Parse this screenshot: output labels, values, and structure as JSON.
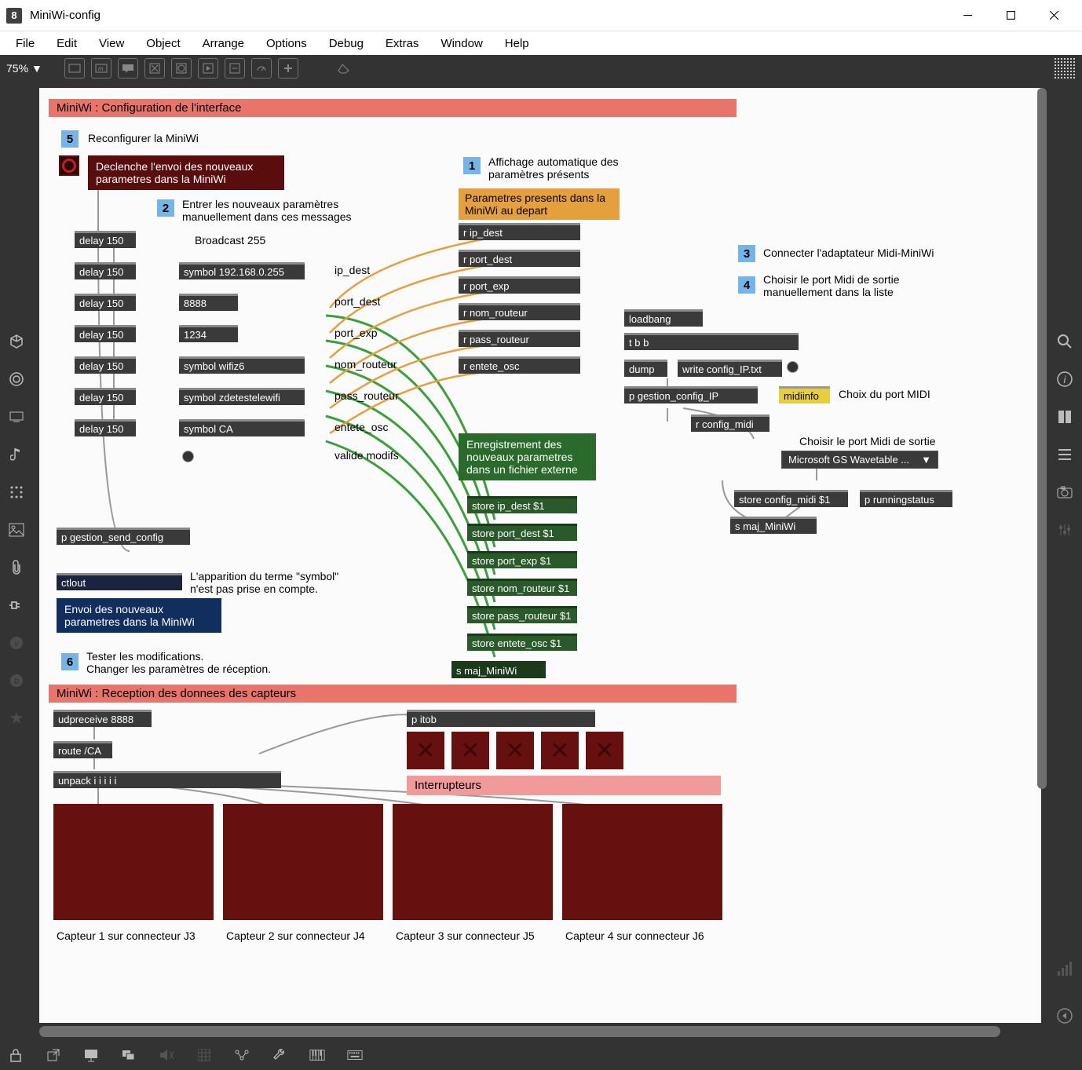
{
  "window": {
    "title": "MiniWi-config"
  },
  "menu": {
    "file": "File",
    "edit": "Edit",
    "view": "View",
    "object": "Object",
    "arrange": "Arrange",
    "options": "Options",
    "debug": "Debug",
    "extras": "Extras",
    "window": "Window",
    "help": "Help"
  },
  "toolbar": {
    "zoom": "75%"
  },
  "patch": {
    "header1": "MiniWi : Configuration de l'interface",
    "header2": "MiniWi : Reception des donnees des capteurs",
    "step5": "5",
    "step5_label": "Reconfigurer la MiniWi",
    "step1": "1",
    "step1_label": "Affichage automatique des paramètres présents",
    "step2": "2",
    "step2_label": "Entrer les nouveaux paramètres manuellement dans ces messages",
    "step3": "3",
    "step3_label": "Connecter l'adaptateur Midi-MiniWi",
    "step4": "4",
    "step4_label": "Choisir le port Midi de sortie manuellement dans la liste",
    "step6": "6",
    "step6_label": "Tester les modifications.\nChanger les paramètres de réception.",
    "bang_label": "Declenche l'envoi des nouveaux parametres dans la MiniWi",
    "orange_params": "Parametres presents dans la MiniWi au depart",
    "broadcast": "Broadcast 255",
    "delays": [
      "delay 150",
      "delay 150",
      "delay 150",
      "delay 150",
      "delay 150",
      "delay 150",
      "delay 150"
    ],
    "symbols": [
      "symbol 192.168.0.255",
      "8888",
      "1234",
      "symbol wifiz6",
      "symbol zdetestelewifi",
      "symbol CA"
    ],
    "labels_col": [
      "ip_dest",
      "port_dest",
      "port_exp",
      "nom_routeur",
      "pass_routeur",
      "entete_osc",
      "valide modifs"
    ],
    "receivers": [
      "r ip_dest",
      "r port_dest",
      "r port_exp",
      "r nom_routeur",
      "r pass_routeur",
      "r entete_osc"
    ],
    "green_header": "Enregistrement des nouveaux parametres dans un fichier externe",
    "stores": [
      "store ip_dest $1",
      "store port_dest $1",
      "store port_exp $1",
      "store nom_routeur $1",
      "store pass_routeur $1",
      "store entete_osc $1"
    ],
    "s_maj": "s maj_MiniWi",
    "p_gestion": "p gestion_send_config",
    "ctlout": "ctlout",
    "symbol_note": "L'apparition du terme \"symbol\" n'est pas prise en compte.",
    "blue_send": "Envoi des nouveaux parametres dans la MiniWi",
    "loadbang": "loadbang",
    "tbb": "t b b",
    "dump": "dump",
    "write": "write config_IP.txt",
    "p_gestion_ip": "p gestion_config_IP",
    "midiinfo": "midiinfo",
    "midi_label": "Choix du port MIDI",
    "r_config_midi": "r config_midi",
    "choisir_midi": "Choisir le port Midi de sortie",
    "midi_dropdown": "Microsoft GS Wavetable ...",
    "store_config_midi": "store config_midi $1",
    "p_runningstatus": "p runningstatus",
    "s_maj2": "s maj_MiniWi",
    "udpreceive": "udpreceive 8888",
    "route": "route /CA",
    "unpack": "unpack i i i i i",
    "p_itob": "p itob",
    "interrupteurs": "Interrupteurs",
    "captors": [
      "Capteur 1 sur connecteur J3",
      "Capteur 2 sur connecteur J4",
      "Capteur 3 sur connecteur J5",
      "Capteur 4 sur connecteur J6"
    ]
  }
}
